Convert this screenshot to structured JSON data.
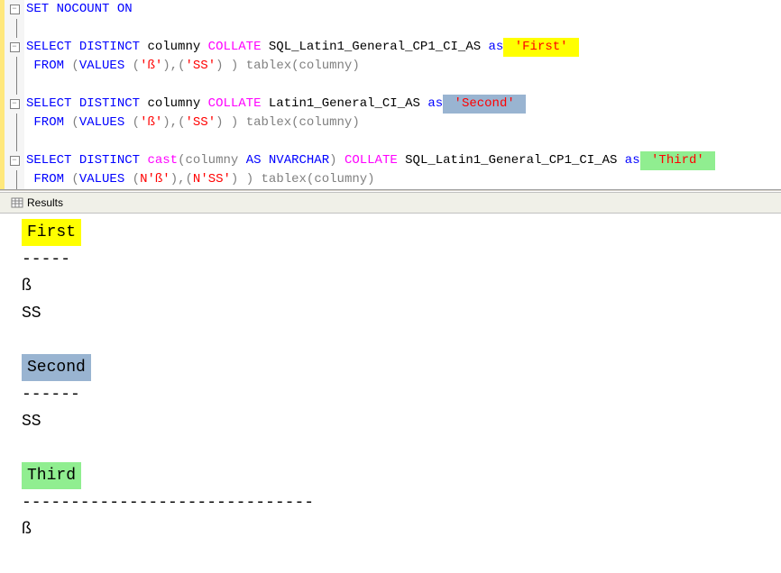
{
  "code": {
    "line1": {
      "set": "SET",
      "nocount": "NOCOUNT",
      "on": "ON"
    },
    "q1": {
      "select": "SELECT",
      "distinct": "DISTINCT",
      "col": " columny ",
      "collate": "COLLATE",
      "collation": " SQL_Latin1_General_CP1_CI_AS ",
      "as": "as",
      "alias": " 'First' ",
      "from": "FROM",
      "op": " (",
      "values": "VALUES",
      "v1p": " (",
      "v1": "'ß'",
      "v1c": "),(",
      "v2": "'SS'",
      "v2c": ") ) tablex(columny)"
    },
    "q2": {
      "select": "SELECT",
      "distinct": "DISTINCT",
      "col": " columny ",
      "collate": "COLLATE",
      "collation": " Latin1_General_CI_AS ",
      "as": "as",
      "alias": " 'Second' ",
      "from": "FROM",
      "op": " (",
      "values": "VALUES",
      "v1p": " (",
      "v1": "'ß'",
      "v1c": "),(",
      "v2": "'SS'",
      "v2c": ") ) tablex(columny)"
    },
    "q3": {
      "select": "SELECT",
      "distinct": "DISTINCT",
      "cast": "cast",
      "cp1": "(columny ",
      "askw": "AS",
      "nv": " NVARCHAR",
      "cp2": ") ",
      "collate": "COLLATE",
      "collation": " SQL_Latin1_General_CP1_CI_AS ",
      "as": "as",
      "alias": " 'Third' ",
      "from": "FROM",
      "op": " (",
      "values": "VALUES",
      "v1p": " (",
      "n1": "N",
      "v1": "'ß'",
      "v1c": "),(",
      "n2": "N",
      "v2": "'SS'",
      "v2c": ") ) tablex(columny)"
    }
  },
  "results_tab": {
    "label": "Results"
  },
  "results": {
    "first": {
      "header": "First",
      "dashes": "-----",
      "rows": [
        "ß",
        "SS"
      ]
    },
    "second": {
      "header": "Second",
      "dashes": "------",
      "rows": [
        "SS"
      ]
    },
    "third": {
      "header": "Third",
      "dashes": "------------------------------",
      "rows": [
        "ß"
      ]
    }
  }
}
